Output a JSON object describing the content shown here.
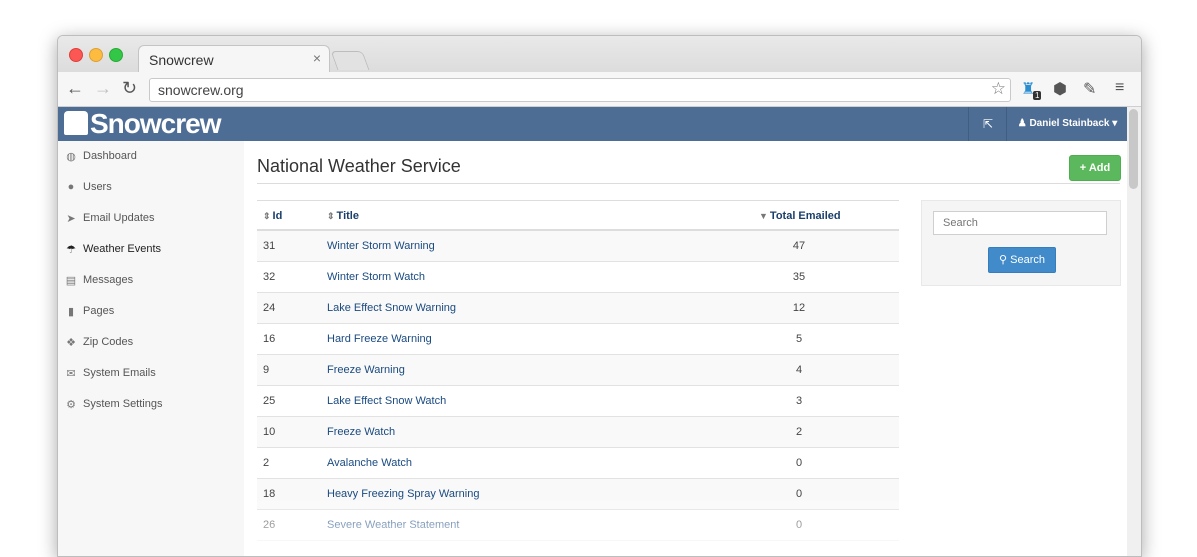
{
  "browser": {
    "tab_title": "Snowcrew",
    "tab_close": "×",
    "url": "snowcrew.org",
    "extension_badge": "1"
  },
  "app": {
    "brand": "Snowcrew",
    "user_menu": "Daniel Stainback ▾"
  },
  "sidebar": {
    "items": [
      {
        "label": "Dashboard",
        "icon": "dashboard-icon",
        "glyph": "◍"
      },
      {
        "label": "Users",
        "icon": "user-icon",
        "glyph": "●"
      },
      {
        "label": "Email Updates",
        "icon": "send-icon",
        "glyph": "➤"
      },
      {
        "label": "Weather Events",
        "icon": "umbrella-icon",
        "glyph": "☂"
      },
      {
        "label": "Messages",
        "icon": "file-text-icon",
        "glyph": "▤"
      },
      {
        "label": "Pages",
        "icon": "file-icon",
        "glyph": "▮"
      },
      {
        "label": "Zip Codes",
        "icon": "cubes-icon",
        "glyph": "❖"
      },
      {
        "label": "System Emails",
        "icon": "envelope-icon",
        "glyph": "✉"
      },
      {
        "label": "System Settings",
        "icon": "cogs-icon",
        "glyph": "⚙"
      }
    ],
    "active": "Weather Events"
  },
  "main": {
    "title": "National Weather Service",
    "add_label": "+ Add",
    "table": {
      "columns": [
        "Id",
        "Title",
        "Total Emailed"
      ],
      "rows": [
        {
          "id": "31",
          "title": "Winter Storm Warning",
          "total": "47"
        },
        {
          "id": "32",
          "title": "Winter Storm Watch",
          "total": "35"
        },
        {
          "id": "24",
          "title": "Lake Effect Snow Warning",
          "total": "12"
        },
        {
          "id": "16",
          "title": "Hard Freeze Warning",
          "total": "5"
        },
        {
          "id": "9",
          "title": "Freeze Warning",
          "total": "4"
        },
        {
          "id": "25",
          "title": "Lake Effect Snow Watch",
          "total": "3"
        },
        {
          "id": "10",
          "title": "Freeze Watch",
          "total": "2"
        },
        {
          "id": "2",
          "title": "Avalanche Watch",
          "total": "0"
        },
        {
          "id": "18",
          "title": "Heavy Freezing Spray Warning",
          "total": "0"
        },
        {
          "id": "26",
          "title": "Severe Weather Statement",
          "total": "0"
        }
      ]
    }
  },
  "search": {
    "placeholder": "Search",
    "button_label": "Search"
  },
  "colors": {
    "navbar": "#4d6d94",
    "add_button": "#5cb85c",
    "search_button": "#428bca",
    "link": "#1a4a80"
  }
}
